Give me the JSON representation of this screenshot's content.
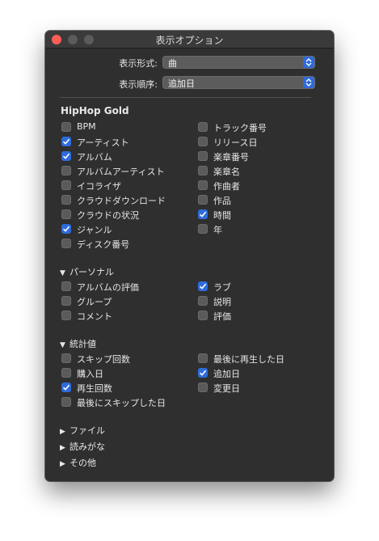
{
  "window": {
    "title": "表示オプション"
  },
  "top": {
    "view_format_label": "表示形式:",
    "view_format_value": "曲",
    "sort_order_label": "表示順序:",
    "sort_order_value": "追加日"
  },
  "playlist_name": "HipHop Gold",
  "columns": {
    "left": [
      {
        "label": "BPM",
        "checked": false
      },
      {
        "label": "アーティスト",
        "checked": true
      },
      {
        "label": "アルバム",
        "checked": true
      },
      {
        "label": "アルバムアーティスト",
        "checked": false
      },
      {
        "label": "イコライザ",
        "checked": false
      },
      {
        "label": "クラウドダウンロード",
        "checked": false
      },
      {
        "label": "クラウドの状況",
        "checked": false
      },
      {
        "label": "ジャンル",
        "checked": true
      },
      {
        "label": "ディスク番号",
        "checked": false
      }
    ],
    "right": [
      {
        "label": "トラック番号",
        "checked": false
      },
      {
        "label": "リリース日",
        "checked": false
      },
      {
        "label": "楽章番号",
        "checked": false
      },
      {
        "label": "楽章名",
        "checked": false
      },
      {
        "label": "作曲者",
        "checked": false
      },
      {
        "label": "作品",
        "checked": false
      },
      {
        "label": "時間",
        "checked": true
      },
      {
        "label": "年",
        "checked": false
      }
    ]
  },
  "personal": {
    "title": "パーソナル",
    "left": [
      {
        "label": "アルバムの評価",
        "checked": false
      },
      {
        "label": "グループ",
        "checked": false
      },
      {
        "label": "コメント",
        "checked": false
      }
    ],
    "right": [
      {
        "label": "ラブ",
        "checked": true
      },
      {
        "label": "説明",
        "checked": false
      },
      {
        "label": "評価",
        "checked": false
      }
    ]
  },
  "stats": {
    "title": "統計値",
    "left": [
      {
        "label": "スキップ回数",
        "checked": false
      },
      {
        "label": "購入日",
        "checked": false
      },
      {
        "label": "再生回数",
        "checked": true
      },
      {
        "label": "最後にスキップした日",
        "checked": false
      }
    ],
    "right": [
      {
        "label": "最後に再生した日",
        "checked": false
      },
      {
        "label": "追加日",
        "checked": true
      },
      {
        "label": "変更日",
        "checked": false
      }
    ]
  },
  "collapsed_sections": [
    {
      "label": "ファイル"
    },
    {
      "label": "読みがな"
    },
    {
      "label": "その他"
    }
  ],
  "colors": {
    "accent": "#2e6bdb",
    "background": "#2f2f2f",
    "close": "#fd5f57"
  }
}
